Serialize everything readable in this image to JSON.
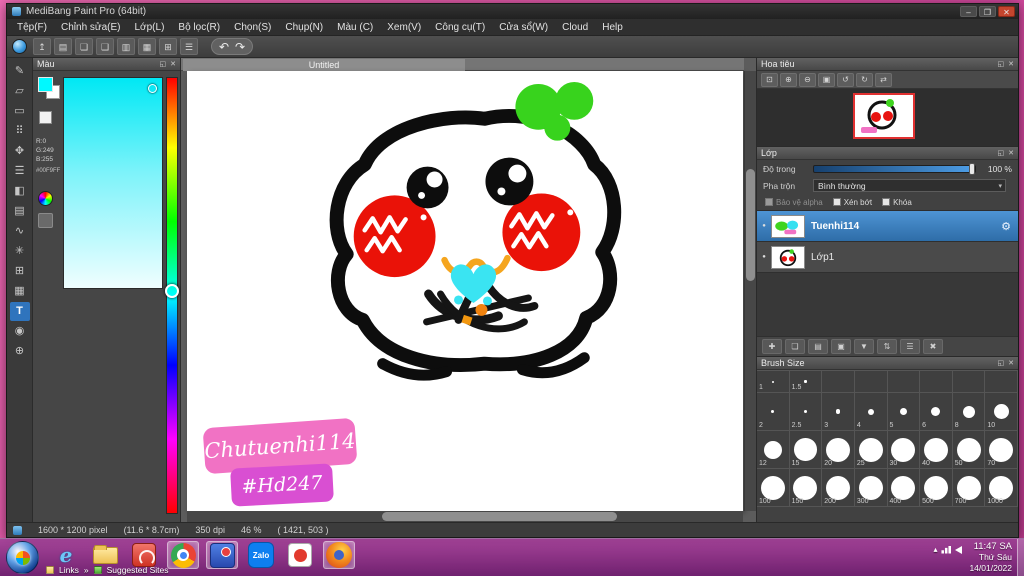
{
  "window": {
    "title": "MediBang Paint Pro (64bit)",
    "controls": {
      "minimize": "–",
      "maximize": "❐",
      "close": "✕"
    }
  },
  "menubar": {
    "items": [
      "Tệp(F)",
      "Chỉnh sửa(E)",
      "Lớp(L)",
      "Bộ lọc(R)",
      "Chọn(S)",
      "Chụp(N)",
      "Màu (C)",
      "Xem(V)",
      "Công cụ(T)",
      "Cửa sổ(W)",
      "Cloud",
      "Help"
    ]
  },
  "toolbar": {
    "icons": [
      {
        "name": "save-icon",
        "glyph": "↥"
      },
      {
        "name": "export-icon",
        "glyph": "▤"
      },
      {
        "name": "comment-icon",
        "glyph": "❏"
      },
      {
        "name": "chat-icon",
        "glyph": "❑"
      },
      {
        "name": "pages-icon",
        "glyph": "▥"
      },
      {
        "name": "grid-icon",
        "glyph": "▦"
      },
      {
        "name": "panel-layout-icon",
        "glyph": "⊞"
      },
      {
        "name": "material-icon",
        "glyph": "☰"
      }
    ],
    "undo_glyph": "↶",
    "redo_glyph": "↷"
  },
  "tools": {
    "items": [
      {
        "name": "brush-tool-icon",
        "glyph": "✎"
      },
      {
        "name": "eraser-tool-icon",
        "glyph": "▱"
      },
      {
        "name": "marquee-tool-icon",
        "glyph": "▭"
      },
      {
        "name": "pattern-tool-icon",
        "glyph": "⠿"
      },
      {
        "name": "move-tool-icon",
        "glyph": "✥"
      },
      {
        "name": "transform-tool-icon",
        "glyph": "☰"
      },
      {
        "name": "bucket-tool-icon",
        "glyph": "◧"
      },
      {
        "name": "gradient-tool-icon",
        "glyph": "▤"
      },
      {
        "name": "lasso-tool-icon",
        "glyph": "∿"
      },
      {
        "name": "wand-tool-icon",
        "glyph": "✳"
      },
      {
        "name": "divide-tool-icon",
        "glyph": "⊞"
      },
      {
        "name": "shape-tool-icon",
        "glyph": "▦"
      },
      {
        "name": "text-tool-icon",
        "glyph": "T",
        "active": true
      },
      {
        "name": "eyedropper-tool-icon",
        "glyph": "◉"
      },
      {
        "name": "zoom-tool-icon",
        "glyph": "⊕"
      }
    ]
  },
  "color_panel": {
    "title": "Màu",
    "r": "R:0",
    "g": "G:249",
    "b": "B:255",
    "hex": "#00F9FF",
    "current_color": "#00F9FF"
  },
  "panels": {
    "float_glyph": "◱",
    "close_glyph": "✕",
    "caret_glyph": "▾",
    "eye_glyph": "●"
  },
  "document": {
    "tab": "Untitled"
  },
  "artwork": {
    "badge_line1": "Chutuenhi114",
    "badge_line2": "#Hd247"
  },
  "navigator": {
    "title": "Hoa tiêu",
    "buttons": [
      {
        "name": "nav-fit-icon",
        "glyph": "⊡"
      },
      {
        "name": "nav-zoom-in-icon",
        "glyph": "⊕"
      },
      {
        "name": "nav-zoom-out-icon",
        "glyph": "⊖"
      },
      {
        "name": "nav-actual-pixels-icon",
        "glyph": "▣"
      },
      {
        "name": "nav-rotate-left-icon",
        "glyph": "↺"
      },
      {
        "name": "nav-rotate-right-icon",
        "glyph": "↻"
      },
      {
        "name": "nav-reset-icon",
        "glyph": "⇄"
      }
    ]
  },
  "layers_panel": {
    "title": "Lớp",
    "opacity_label": "Độ trong",
    "opacity_value": "100 %",
    "blend_label": "Pha trộn",
    "blend_value": "Bình thường",
    "checkboxes": [
      {
        "label": "Bảo vệ alpha",
        "cls": "dim"
      },
      {
        "label": "Xén bớt"
      },
      {
        "label": "Khóa"
      }
    ],
    "layers": [
      {
        "name": "Tuenhi114"
      },
      {
        "name": "Lớp1"
      }
    ],
    "gear_glyph": "⚙",
    "buttons": [
      {
        "name": "layer-add-icon",
        "glyph": "✚"
      },
      {
        "name": "layer-duplicate-icon",
        "glyph": "❏"
      },
      {
        "name": "layer-merge-icon",
        "glyph": "▤"
      },
      {
        "name": "layer-folder-icon",
        "glyph": "▣"
      },
      {
        "name": "layer-move-down-icon",
        "glyph": "▼"
      },
      {
        "name": "layer-order-icon",
        "glyph": "⇅"
      },
      {
        "name": "layer-menu-icon",
        "glyph": "☰"
      },
      {
        "name": "layer-delete-icon",
        "glyph": "✖"
      }
    ]
  },
  "brush_panel": {
    "title": "Brush Size",
    "sizes": [
      "1",
      "1.5",
      "",
      "",
      "",
      "",
      "",
      "",
      "2",
      "2.5",
      "3",
      "4",
      "5",
      "6",
      "8",
      "10",
      "12",
      "15",
      "20",
      "25",
      "30",
      "40",
      "50",
      "70",
      "100",
      "150",
      "200",
      "300",
      "400",
      "500",
      "700",
      "1000"
    ]
  },
  "statusbar": {
    "size": "1600 * 1200 pixel",
    "dimensions": "(11.6 * 8.7cm)",
    "dpi": "350 dpi",
    "zoom": "46 %",
    "coords": "( 1421, 503 )"
  },
  "taskbar": {
    "ie_glyph": "e",
    "zalo_label": "Zalo",
    "links_label": "Links",
    "links_chevron": "»",
    "suggested_label": "Suggested Sites",
    "tray_expand_glyph": "▴",
    "clock": {
      "time": "11:47 SA",
      "weekday": "Thứ Sáu",
      "date": "14/01/2022"
    }
  }
}
